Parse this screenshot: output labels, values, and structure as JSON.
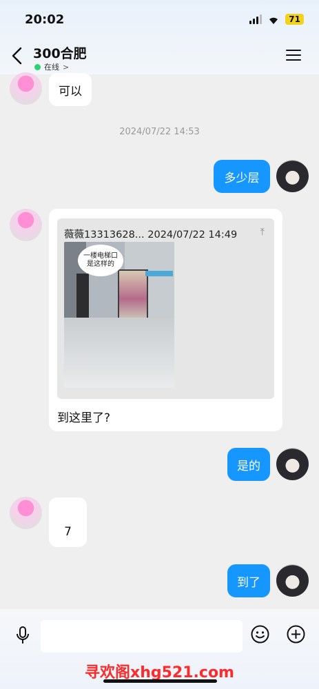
{
  "status": {
    "time": "20:02",
    "battery": "71"
  },
  "header": {
    "title": "300合肥",
    "online_status": "在线",
    "online_chevron": ">"
  },
  "messages": {
    "m1_text": "可以",
    "timestamp": "2024/07/22 14:53",
    "m2_text": "多少层",
    "quote_header": "薇薇13313628... 2024/07/22 14:49",
    "quote_pin": "⤒",
    "photo_speech": "一楼电梯口是这样的",
    "m3_text": "到这里了?",
    "m4_text": "是的",
    "m5_text": "7",
    "m6_text": "到了"
  },
  "input": {
    "placeholder": ""
  },
  "watermark": "寻欢阁xhg521.com",
  "colors": {
    "sent_bubble": "#1597ff",
    "online": "#2bd46f",
    "battery": "#f2d21b",
    "watermark": "#ff2a2a"
  },
  "icons": {
    "back": "chevron-left-icon",
    "menu": "hamburger-menu-icon",
    "voice": "microphone-icon",
    "emoji": "smiley-icon",
    "more": "plus-circle-icon"
  }
}
